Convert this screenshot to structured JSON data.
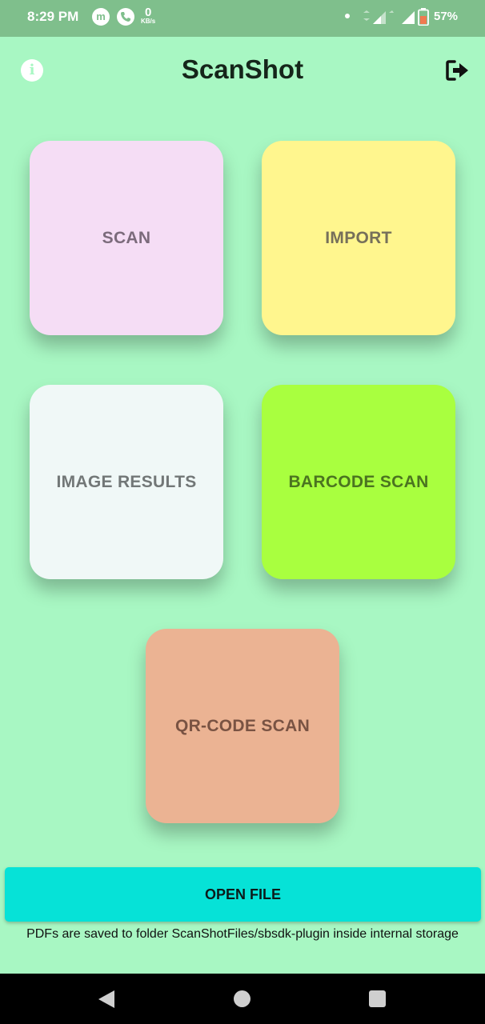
{
  "status_bar": {
    "time": "8:29 PM",
    "net_speed_value": "0",
    "net_speed_unit": "KB/s",
    "battery": "57%",
    "icons": [
      "m-app-icon",
      "phone-icon",
      "signal-icon",
      "battery-icon"
    ]
  },
  "app_bar": {
    "title": "ScanShot",
    "info_icon": "info-icon",
    "info_glyph": "i",
    "logout_icon": "logout-icon"
  },
  "tiles": {
    "scan": "SCAN",
    "import": "IMPORT",
    "image_results": "IMAGE RESULTS",
    "barcode_scan": "BARCODE SCAN",
    "qr_code_scan": "QR-CODE SCAN"
  },
  "tile_colors": {
    "scan": "#f5ddf5",
    "import": "#fff68e",
    "image_results": "#f0f8f7",
    "barcode_scan": "#a9ff3f",
    "qr_code_scan": "#ebb393"
  },
  "accent_colors": {
    "background": "#a8f7c3",
    "status_bar": "#7fbf8c",
    "open_file_button": "#06e2d7"
  },
  "footer": {
    "open_file_label": "OPEN FILE",
    "note": "PDFs are saved to folder ScanShotFiles/sbsdk-plugin inside internal storage"
  },
  "nav_bar": {
    "icons": [
      "back-icon",
      "home-icon",
      "recents-icon"
    ]
  }
}
